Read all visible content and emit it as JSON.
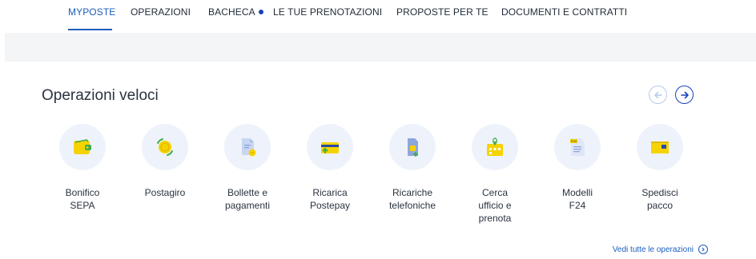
{
  "nav": {
    "items": [
      {
        "label": "MYPOSTE"
      },
      {
        "label": "OPERAZIONI"
      },
      {
        "label": "BACHECA"
      },
      {
        "label": "LE TUE PRENOTAZIONI"
      },
      {
        "label": "PROPOSTE PER TE"
      },
      {
        "label": "DOCUMENTI E CONTRATTI"
      }
    ],
    "active": "MYPOSTE"
  },
  "section": {
    "title": "Operazioni veloci"
  },
  "tiles": [
    {
      "label": "Bonifico\nSEPA",
      "icon": "wallet-icon"
    },
    {
      "label": "Postagiro",
      "icon": "coin-exchange-icon"
    },
    {
      "label": "Bollette e\npagamenti",
      "icon": "bill-icon"
    },
    {
      "label": "Ricarica\nPostepay",
      "icon": "card-topup-icon"
    },
    {
      "label": "Ricariche\ntelefoniche",
      "icon": "sim-card-icon"
    },
    {
      "label": "Cerca\nufficio e\nprenota",
      "icon": "map-pin-calendar-icon"
    },
    {
      "label": "Modelli\nF24",
      "icon": "f24-document-icon",
      "icon_text": "F24"
    },
    {
      "label": "Spedisci\npacco",
      "icon": "package-icon"
    }
  ],
  "footer": {
    "see_all_label": "Vedi tutte le operazioni"
  },
  "colors": {
    "accent": "#1c5dbf",
    "dot": "#1c3fbe",
    "tile_bg": "#eef3fb",
    "icon_yellow": "#f5d300",
    "icon_green": "#3fae49"
  }
}
